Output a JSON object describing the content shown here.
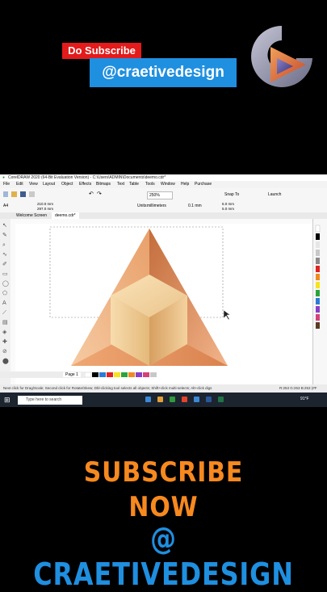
{
  "promo": {
    "subscribe_label": "Do Subscribe",
    "handle": "@craetivedesign",
    "cta_line1": "SUBSCRIBE",
    "cta_line2": "NOW",
    "cta_line3": "@ CRAETIVEDESIGN"
  },
  "app": {
    "title": "CorelDRAW 2020 (64-Bit Evaluation Version) - C:\\Users\\ADMIN\\Documents\\deemo.cdr*",
    "menu": [
      "File",
      "Edit",
      "View",
      "Layout",
      "Object",
      "Effects",
      "Bitmaps",
      "Text",
      "Table",
      "Tools",
      "Window",
      "Help",
      "Purchase"
    ],
    "zoom": "250%",
    "snap_to": "Snap To",
    "launch": "Launch",
    "page_size": "A4",
    "width": "210.0 mm",
    "height": "297.0 mm",
    "units_label": "Units:",
    "units": "millimeters",
    "nudge": "0.1 mm",
    "dup_x": "5.0 mm",
    "dup_y": "5.0 mm",
    "tabs": [
      "Welcome Screen",
      "deemo.cdr*"
    ],
    "page_tab": "Page 1",
    "status": "Next click for Drag/Scale; Second click for Rotate/Skew; Dbl-clicking tool selects all objects; Shift+click multi-selects; Alt+click digs",
    "color_readout": "R:253 G:253 B:253 (#F",
    "taskbar_search": "Type here to search",
    "temperature": "91°F"
  },
  "colors": {
    "accent_red": "#e31b1b",
    "accent_blue": "#1f8fe0",
    "accent_orange": "#f7891f"
  }
}
